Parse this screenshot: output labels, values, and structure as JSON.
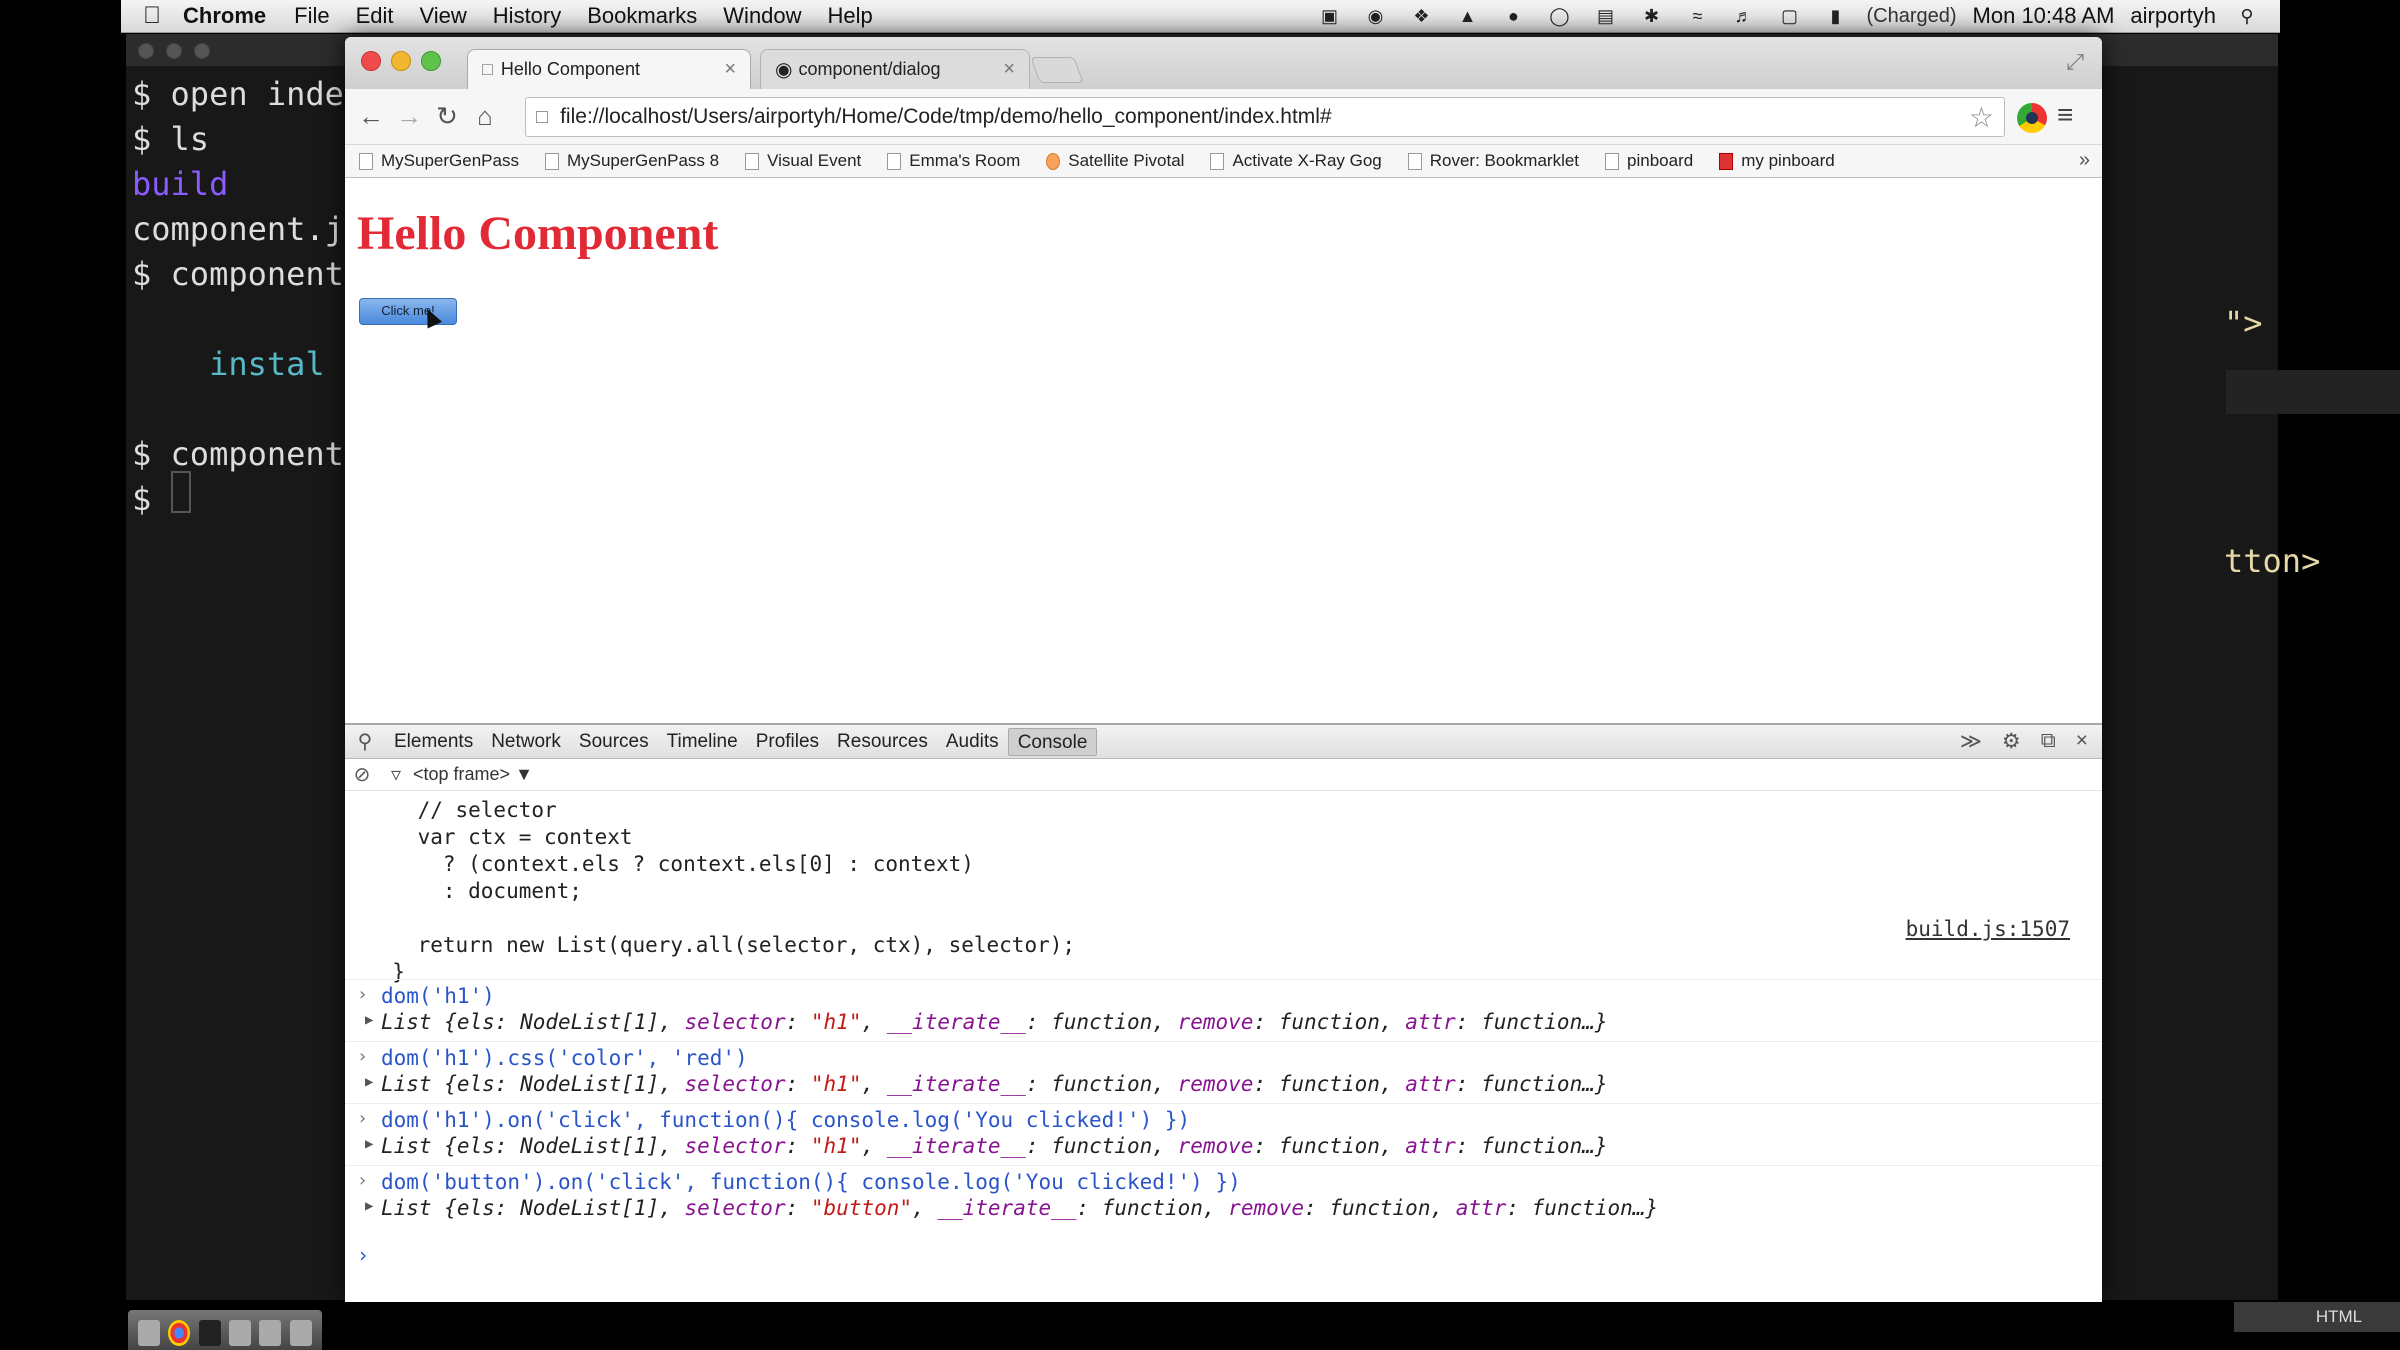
{
  "menubar": {
    "app": "Chrome",
    "menus": [
      "File",
      "Edit",
      "View",
      "History",
      "Bookmarks",
      "Window",
      "Help"
    ],
    "battery": "(Charged)",
    "clock": "Mon 10:48 AM",
    "user": "airportyh"
  },
  "terminal": {
    "lines": [
      "$ open inde",
      "$ ls",
      "build",
      "component.j",
      "$ component",
      "",
      "    instal",
      "",
      "$ component",
      "$ "
    ],
    "right_top": "\">",
    "right_mid": "tton>",
    "status": "HTML"
  },
  "browser": {
    "tabs": [
      {
        "title": "Hello Component",
        "active": true
      },
      {
        "title": "component/dialog",
        "active": false
      }
    ],
    "url": "file://localhost/Users/airportyh/Home/Code/tmp/demo/hello_component/index.html#",
    "bookmarks": [
      "MySuperGenPass",
      "MySuperGenPass 8",
      "Visual Event",
      "Emma's Room",
      "Satellite Pivotal",
      "Activate X-Ray Gog",
      "Rover: Bookmarklet",
      "pinboard",
      "my pinboard"
    ]
  },
  "page": {
    "heading": "Hello Component",
    "heading_color": "#e12a36",
    "button_label": "Click me!"
  },
  "devtools": {
    "tabs": [
      "Elements",
      "Network",
      "Sources",
      "Timeline",
      "Profiles",
      "Resources",
      "Audits",
      "Console"
    ],
    "active_tab": "Console",
    "frame": "<top frame>",
    "code_lines": [
      "    // selector",
      "    var ctx = context",
      "      ? (context.els ? context.els[0] : context)",
      "      : document;",
      "",
      "    return new List(query.all(selector, ctx), selector);",
      "  }"
    ],
    "source_link": "build.js:1507",
    "entries": [
      {
        "cmd": "dom('h1')",
        "sel": "\"h1\""
      },
      {
        "cmd": "dom('h1').css('color', 'red')",
        "sel": "\"h1\""
      },
      {
        "cmd": "dom('h1').on('click', function(){ console.log('You clicked!') })",
        "sel": "\"h1\""
      },
      {
        "cmd": "dom('button').on('click', function(){ console.log('You clicked!') })",
        "sel": "\"button\""
      }
    ],
    "result_prefix": "List {els: NodeList[1], ",
    "result_selector_key": "selector",
    "result_iterate": "__iterate__",
    "result_function": "function",
    "result_remove": "remove",
    "result_attr": "attr",
    "result_tail": "function…}"
  }
}
